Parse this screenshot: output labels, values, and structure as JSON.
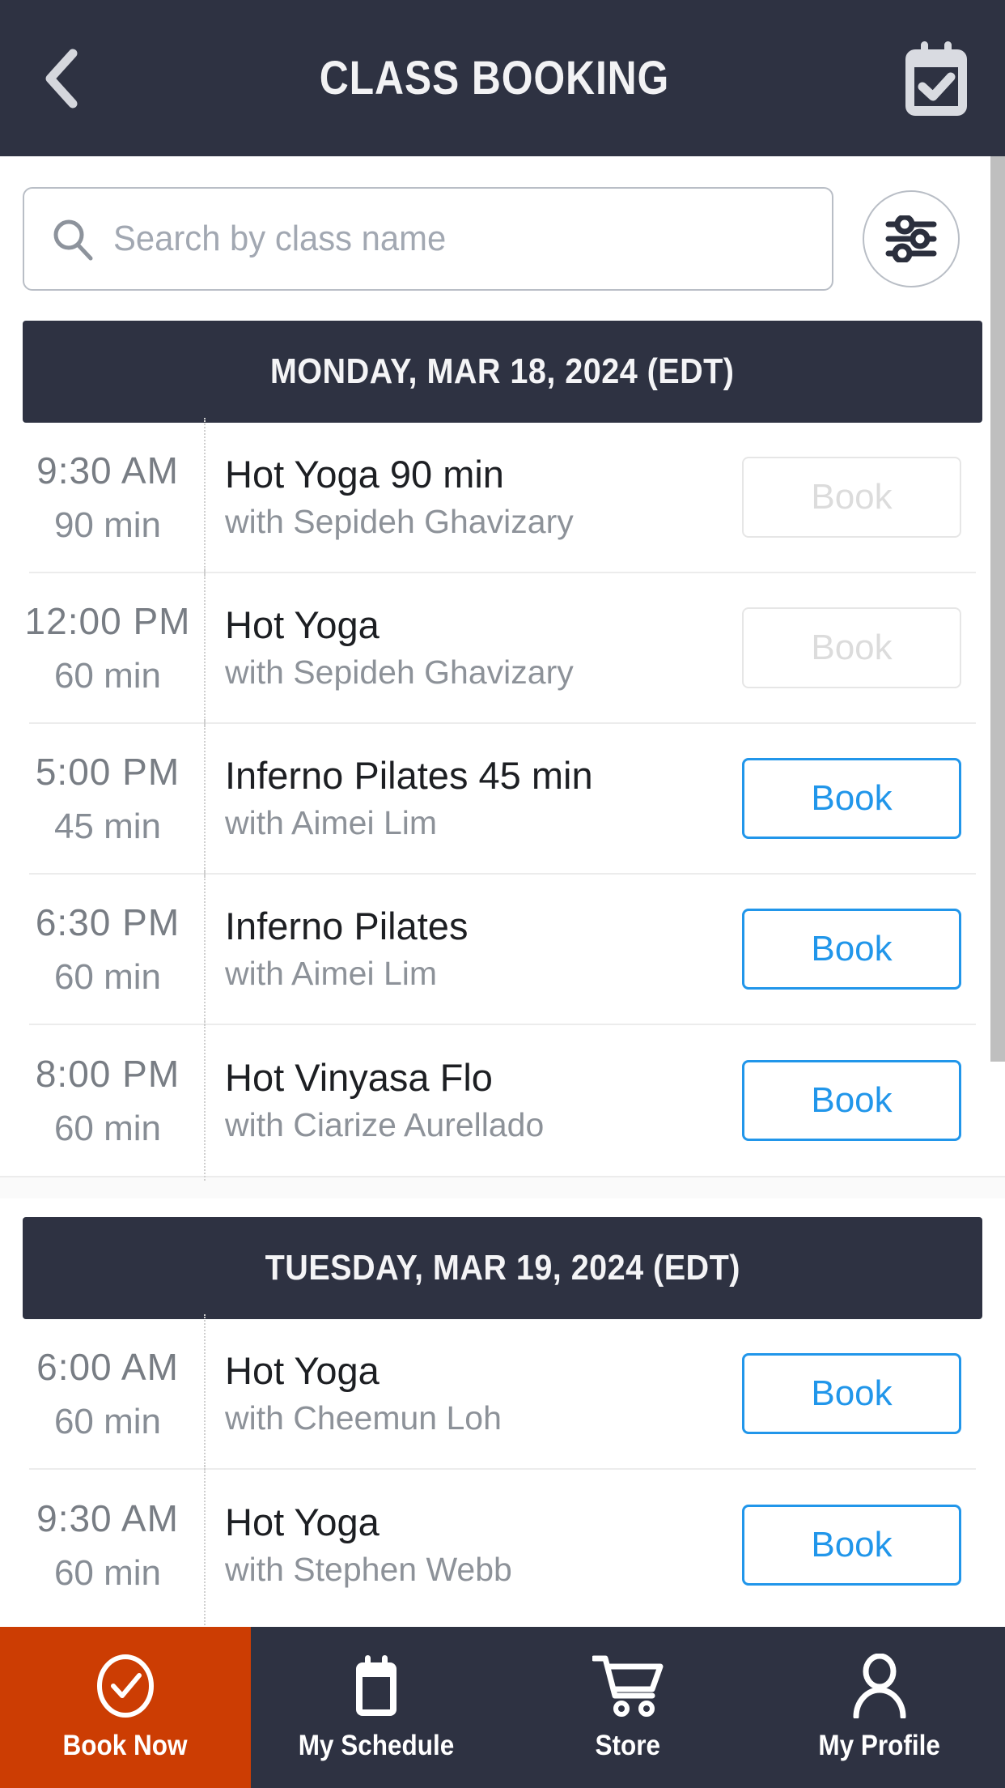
{
  "header": {
    "title": "CLASS BOOKING",
    "back_icon": "chevron-left-icon",
    "calendar_icon": "calendar-check-icon"
  },
  "search": {
    "placeholder": "Search by class name",
    "value": "",
    "search_icon": "search-icon",
    "filter_icon": "filter-sliders-icon"
  },
  "colors": {
    "header_bg": "#2e3242",
    "accent_blue": "#2196ea",
    "active_tab_orange": "#cc3d03",
    "muted_text": "#8d9299",
    "disabled_border": "#e6e6e6"
  },
  "days": [
    {
      "label": "MONDAY, MAR 18, 2024 (EDT)",
      "classes": [
        {
          "time": "9:30  AM",
          "duration": "90 min",
          "name": "Hot Yoga 90 min",
          "instructor": "with Sepideh Ghavizary",
          "book_label": "Book",
          "enabled": false
        },
        {
          "time": "12:00  PM",
          "duration": "60 min",
          "name": "Hot Yoga",
          "instructor": "with Sepideh Ghavizary",
          "book_label": "Book",
          "enabled": false
        },
        {
          "time": "5:00  PM",
          "duration": "45 min",
          "name": "Inferno Pilates 45 min",
          "instructor": "with Aimei Lim",
          "book_label": "Book",
          "enabled": true
        },
        {
          "time": "6:30  PM",
          "duration": "60 min",
          "name": "Inferno Pilates",
          "instructor": "with Aimei Lim",
          "book_label": "Book",
          "enabled": true
        },
        {
          "time": "8:00  PM",
          "duration": "60 min",
          "name": "Hot Vinyasa Flo",
          "instructor": "with Ciarize Aurellado",
          "book_label": "Book",
          "enabled": true
        }
      ]
    },
    {
      "label": "TUESDAY, MAR 19, 2024 (EDT)",
      "classes": [
        {
          "time": "6:00  AM",
          "duration": "60 min",
          "name": "Hot Yoga",
          "instructor": "with Cheemun Loh",
          "book_label": "Book",
          "enabled": true
        },
        {
          "time": "9:30  AM",
          "duration": "60 min",
          "name": "Hot Yoga",
          "instructor": "with Stephen Webb",
          "book_label": "Book",
          "enabled": true
        }
      ]
    }
  ],
  "bottom_nav": [
    {
      "label": "Book Now",
      "icon": "check-circle-icon",
      "active": true
    },
    {
      "label": "My Schedule",
      "icon": "calendar-icon",
      "active": false
    },
    {
      "label": "Store",
      "icon": "shopping-cart-icon",
      "active": false
    },
    {
      "label": "My Profile",
      "icon": "person-icon",
      "active": false
    }
  ]
}
